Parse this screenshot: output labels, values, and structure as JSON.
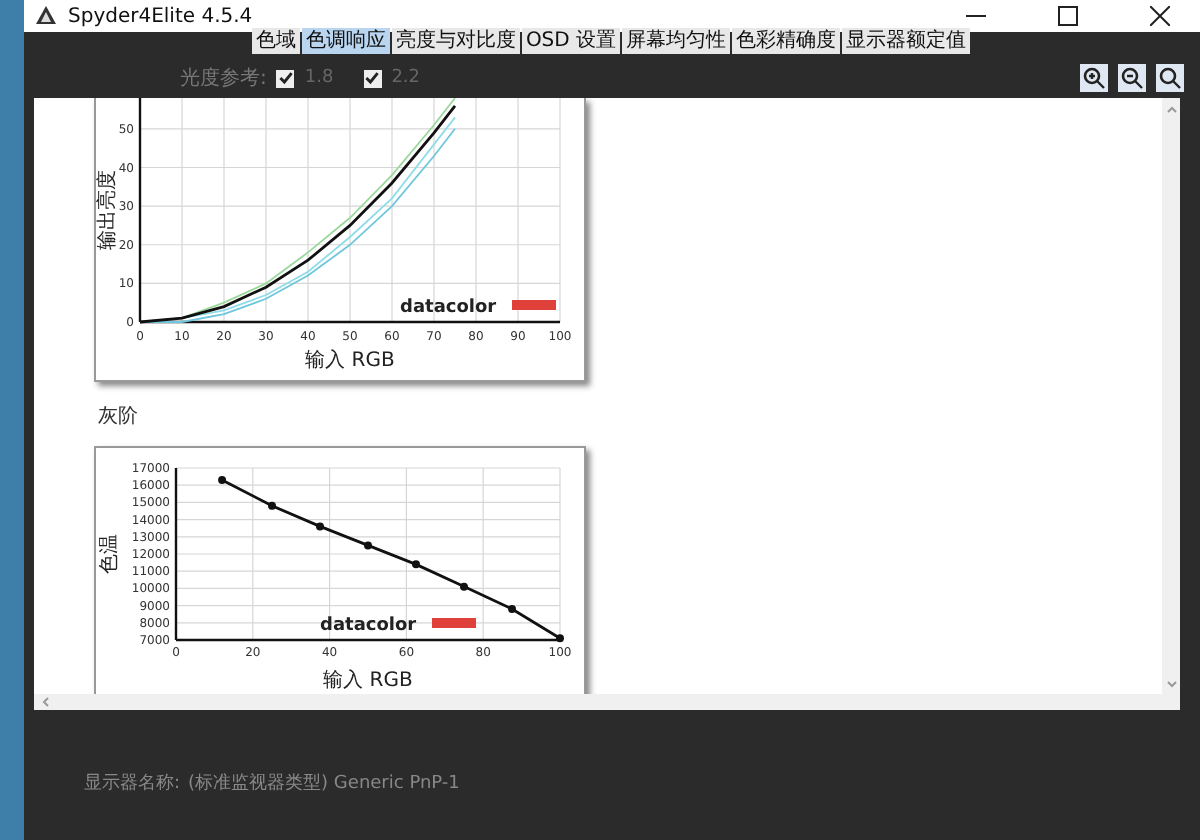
{
  "window": {
    "title": "Spyder4Elite 4.5.4"
  },
  "tabs": [
    {
      "label": "色域",
      "selected": false
    },
    {
      "label": "色调响应",
      "selected": true
    },
    {
      "label": "亮度与对比度",
      "selected": false
    },
    {
      "label": "OSD 设置",
      "selected": false
    },
    {
      "label": "屏幕均匀性",
      "selected": false
    },
    {
      "label": "色彩精确度",
      "selected": false
    },
    {
      "label": "显示器额定值",
      "selected": false
    }
  ],
  "toolbar": {
    "label": "光度参考:",
    "references": [
      {
        "label": "1.8",
        "checked": true
      },
      {
        "label": "2.2",
        "checked": true
      }
    ]
  },
  "charts": [
    {
      "logo": "datacolor",
      "chart_data": {
        "type": "line",
        "grid": true,
        "xlabel": "输入 RGB",
        "ylabel": "输出亮度",
        "x": [
          0,
          10,
          20,
          30,
          40,
          50,
          60,
          70,
          75
        ],
        "xlim": [
          0,
          100
        ],
        "ylim": [
          0,
          58
        ],
        "xticks": [
          0,
          10,
          20,
          30,
          40,
          50,
          60,
          70,
          80,
          90,
          100
        ],
        "yticks": [
          0,
          10,
          20,
          30,
          40,
          50
        ],
        "series": [
          {
            "color": "#9bd89b",
            "values": [
              0,
              1,
              5,
              10,
              18,
              27,
              38,
              51,
              58
            ]
          },
          {
            "color": "#8fdde8",
            "values": [
              0,
              1,
              3,
              7,
              13,
              22,
              32,
              46,
              53
            ]
          },
          {
            "color": "#6fc7dc",
            "values": [
              0,
              0,
              2,
              6,
              12,
              20,
              30,
              43,
              50
            ]
          },
          {
            "color": "#111111",
            "values": [
              0,
              1,
              4,
              9,
              16,
              25,
              36,
              49,
              56
            ]
          }
        ]
      }
    },
    {
      "heading": "灰阶",
      "logo": "datacolor",
      "chart_data": {
        "type": "line",
        "grid": true,
        "xlabel": "输入 RGB",
        "ylabel": "色温",
        "x": [
          12,
          25,
          37.5,
          50,
          62.5,
          75,
          87.5,
          100
        ],
        "xlim": [
          0,
          100
        ],
        "ylim": [
          7000,
          17000
        ],
        "xticks": [
          0,
          20,
          40,
          60,
          80,
          100
        ],
        "yticks": [
          7000,
          8000,
          9000,
          10000,
          11000,
          12000,
          13000,
          14000,
          15000,
          16000,
          17000
        ],
        "series": [
          {
            "color": "#111111",
            "marker": "circle",
            "values": [
              16300,
              14800,
              13600,
              12500,
              11400,
              10100,
              8800,
              7100
            ]
          }
        ]
      }
    }
  ],
  "footer": {
    "label": "显示器名称:",
    "value": "(标准监视器类型) Generic PnP-1"
  }
}
